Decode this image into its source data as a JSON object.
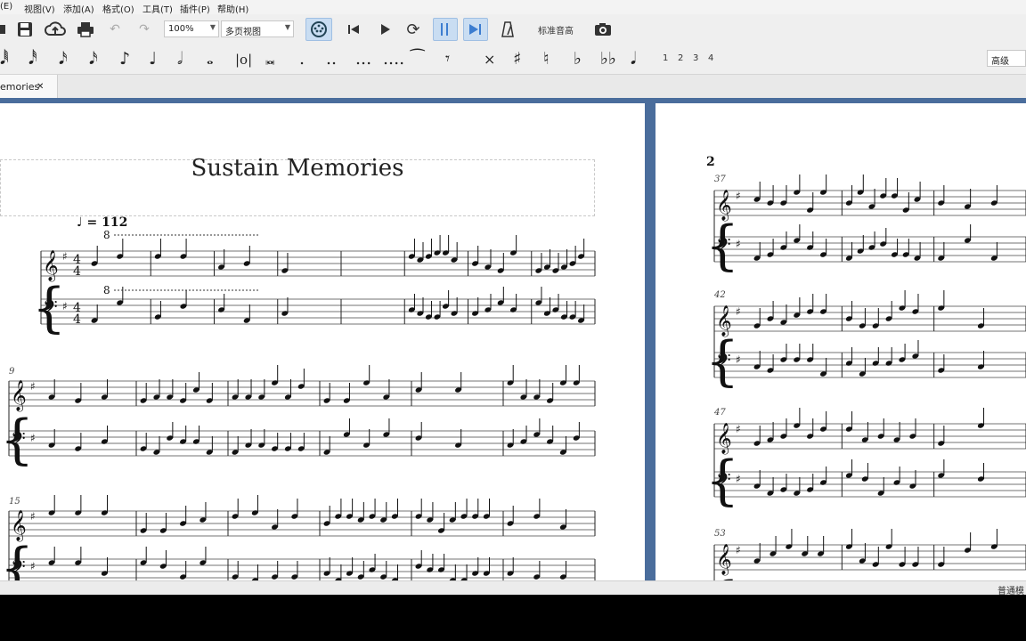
{
  "menu": [
    "(E)",
    "视图(V)",
    "添加(A)",
    "格式(O)",
    "工具(T)",
    "插件(P)",
    "帮助(H)"
  ],
  "toolbar": {
    "zoom": "100%",
    "view_mode": "多页视图",
    "concert_pitch": "标准音高"
  },
  "note_input": {
    "dots": [
      ".",
      "..",
      "...",
      "...."
    ],
    "voices": [
      "1",
      "2",
      "3",
      "4"
    ],
    "workspace": "高级"
  },
  "tab": {
    "label": "emories",
    "close": "✕"
  },
  "score": {
    "title": "Sustain Memories",
    "tempo_value": "= 112",
    "ottava": "8",
    "page2_number": "2",
    "page1_measure_numbers": [
      "9",
      "15"
    ],
    "page2_measure_numbers": [
      "37",
      "42",
      "47",
      "53"
    ]
  },
  "status": {
    "text": "普通模"
  },
  "colors": {
    "canvas": "#4a6d9c",
    "active_button": "#c9ddf2"
  }
}
